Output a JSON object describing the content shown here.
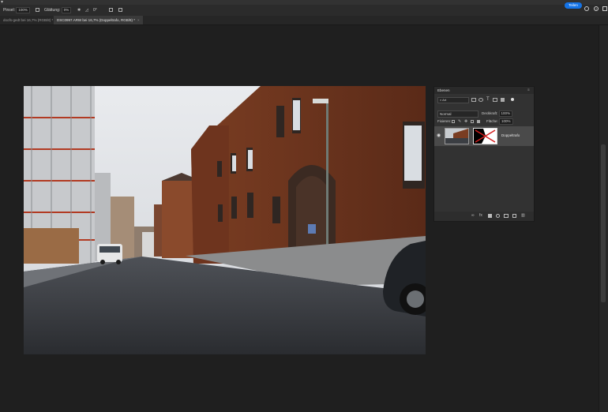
{
  "app": {
    "options": {
      "opacity_label": "Pinsel:",
      "opacity_value": "100%",
      "flow_label": "Glättung:",
      "flow_value": "0%",
      "angle_value": "0°"
    },
    "share_button": "Teilen"
  },
  "tabs": [
    {
      "label": "doofs-gedt bei 16,7% (RGB/8) *",
      "close": "×",
      "active": false
    },
    {
      "label": "DSC0997.ARW bei 16,7% (Doppeltrafo, RGB/8) *",
      "close": "×",
      "active": true
    }
  ],
  "layers_panel": {
    "title": "Ebenen",
    "filter_label": "Art",
    "blend_mode": "Normal",
    "opacity_label": "Deckkraft:",
    "opacity_value": "100%",
    "lock_label": "Fixieren:",
    "fill_label": "Fläche:",
    "fill_value": "100%",
    "layer_name": "Doppeltrafo",
    "visibility_icon": "eye-icon"
  },
  "colors": {
    "accent": "#1473e6",
    "canvas_bg": "#1f1f1f",
    "panel_bg": "#323232"
  }
}
